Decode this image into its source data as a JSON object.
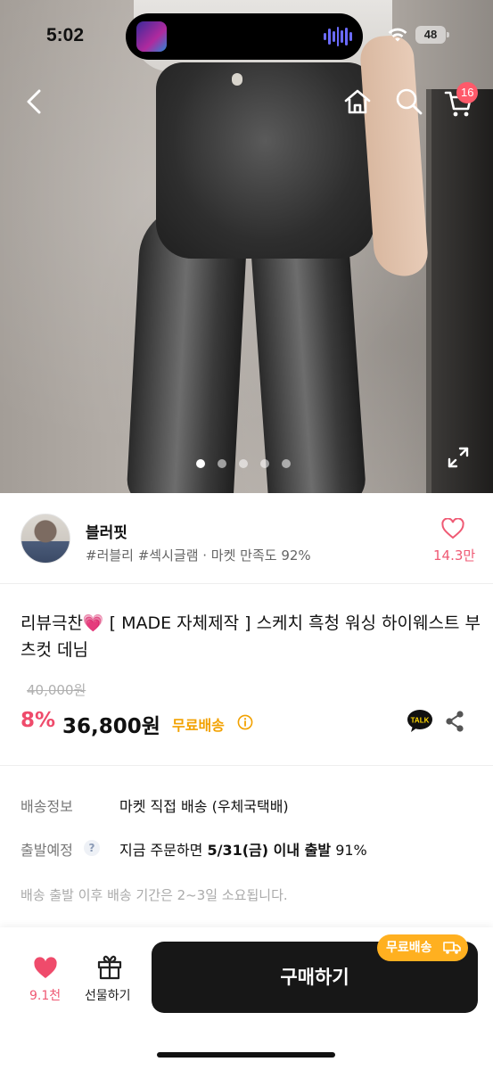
{
  "status_bar": {
    "time": "5:02",
    "battery": "48"
  },
  "nav": {
    "cart_badge": "16"
  },
  "gallery": {
    "dot_count": 5,
    "active_index": 0
  },
  "seller": {
    "name": "블러핏",
    "tags": "#러블리 #섹시글램 · 마켓 만족도 92%",
    "like_count": "14.3만"
  },
  "product": {
    "title_prefix": "리뷰극찬",
    "title_emoji": "💗",
    "title_main": " [ MADE 자체제작 ] 스케치 흑청 워싱 하이웨스트 부츠컷 데님",
    "original_price": "40,000원",
    "discount": "8%",
    "price": "36,800원",
    "free_shipping": "무료배송"
  },
  "shipping": {
    "info_label": "배송정보",
    "info_value": "마켓 직접 배송 (우체국택배)",
    "depart_label": "출발예정",
    "depart_value_prefix": "지금 주문하면 ",
    "depart_value_bold": "5/31(금) 이내 출발",
    "depart_value_suffix": " 91%",
    "note": "배송 출발 이후 배송 기간은 2~3일 소요됩니다."
  },
  "bottom_bar": {
    "heart_count": "9.1천",
    "gift_label": "선물하기",
    "buy_label": "구매하기",
    "free_badge": "무료배송"
  },
  "colors": {
    "accent_pink": "#ef4b6b",
    "free_shipping": "#f2a100",
    "buy_button": "#171717"
  }
}
